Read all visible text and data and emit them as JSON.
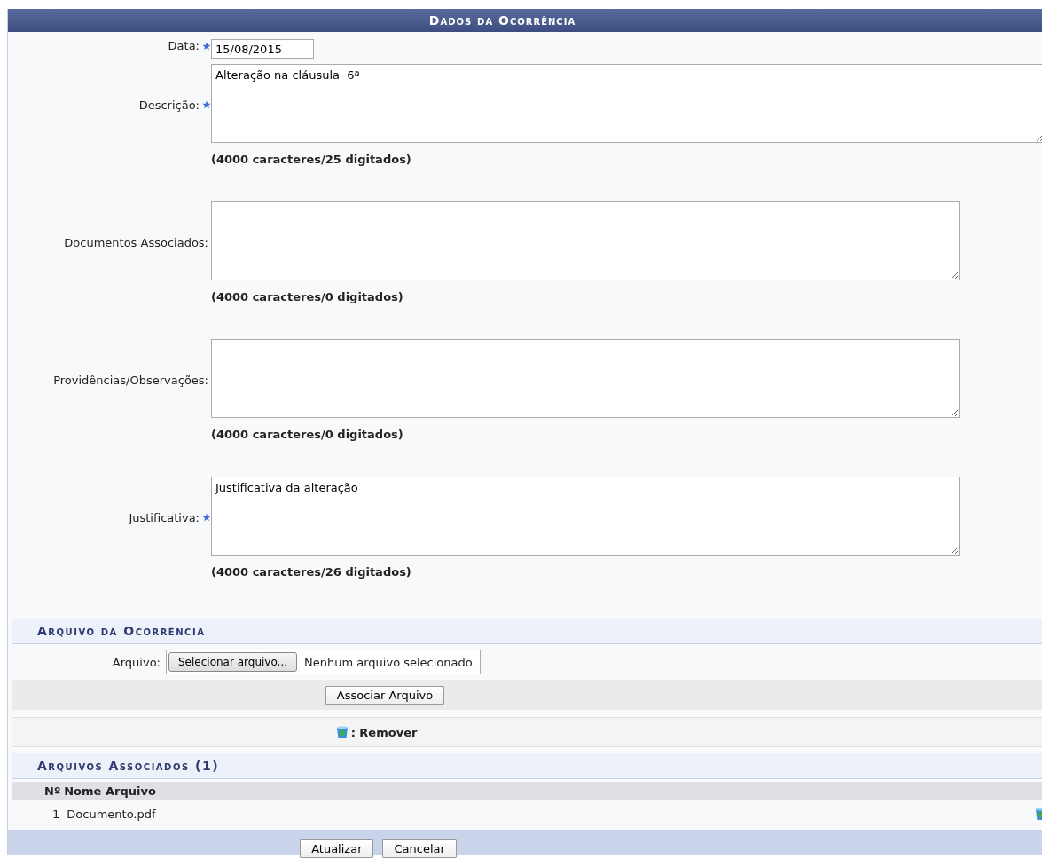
{
  "title": "Dados da Ocorrência",
  "fields": [
    {
      "kind": "input",
      "label": "Data:",
      "required": true,
      "value": "15/08/2015"
    },
    {
      "kind": "textarea",
      "label": "Descrição:",
      "required": true,
      "value": "Alteração na cláusula  6ª",
      "counter": "(4000 caracteres/25 digitados)",
      "wide": true
    },
    {
      "kind": "textarea",
      "label": "Documentos Associados:",
      "required": false,
      "counter": "(4000 caracteres/0 digitados)",
      "wide": false
    },
    {
      "kind": "textarea",
      "label": "Providências/Observações:",
      "required": false,
      "counter": "(4000 caracteres/0 digitados)",
      "wide": false
    },
    {
      "kind": "textarea",
      "label": "Justificativa:",
      "required": true,
      "value": "Justificativa da alteração",
      "counter": "(4000 caracteres/26 digitados)",
      "wide": false
    }
  ],
  "file_section": {
    "title": "Arquivo da Ocorrência",
    "label": "Arquivo:",
    "choose_button": "Selecionar arquivo...",
    "no_file": "Nenhum arquivo selecionado.",
    "associate_button": "Associar Arquivo"
  },
  "legend": ": Remover",
  "files_section": {
    "title": "Arquivos Associados (1)",
    "columns": [
      "Nº",
      "Nome Arquivo"
    ],
    "rows": [
      {
        "number": "1",
        "name": "Documento.pdf"
      }
    ]
  },
  "buttons": [
    "Atualizar",
    "Cancelar"
  ]
}
